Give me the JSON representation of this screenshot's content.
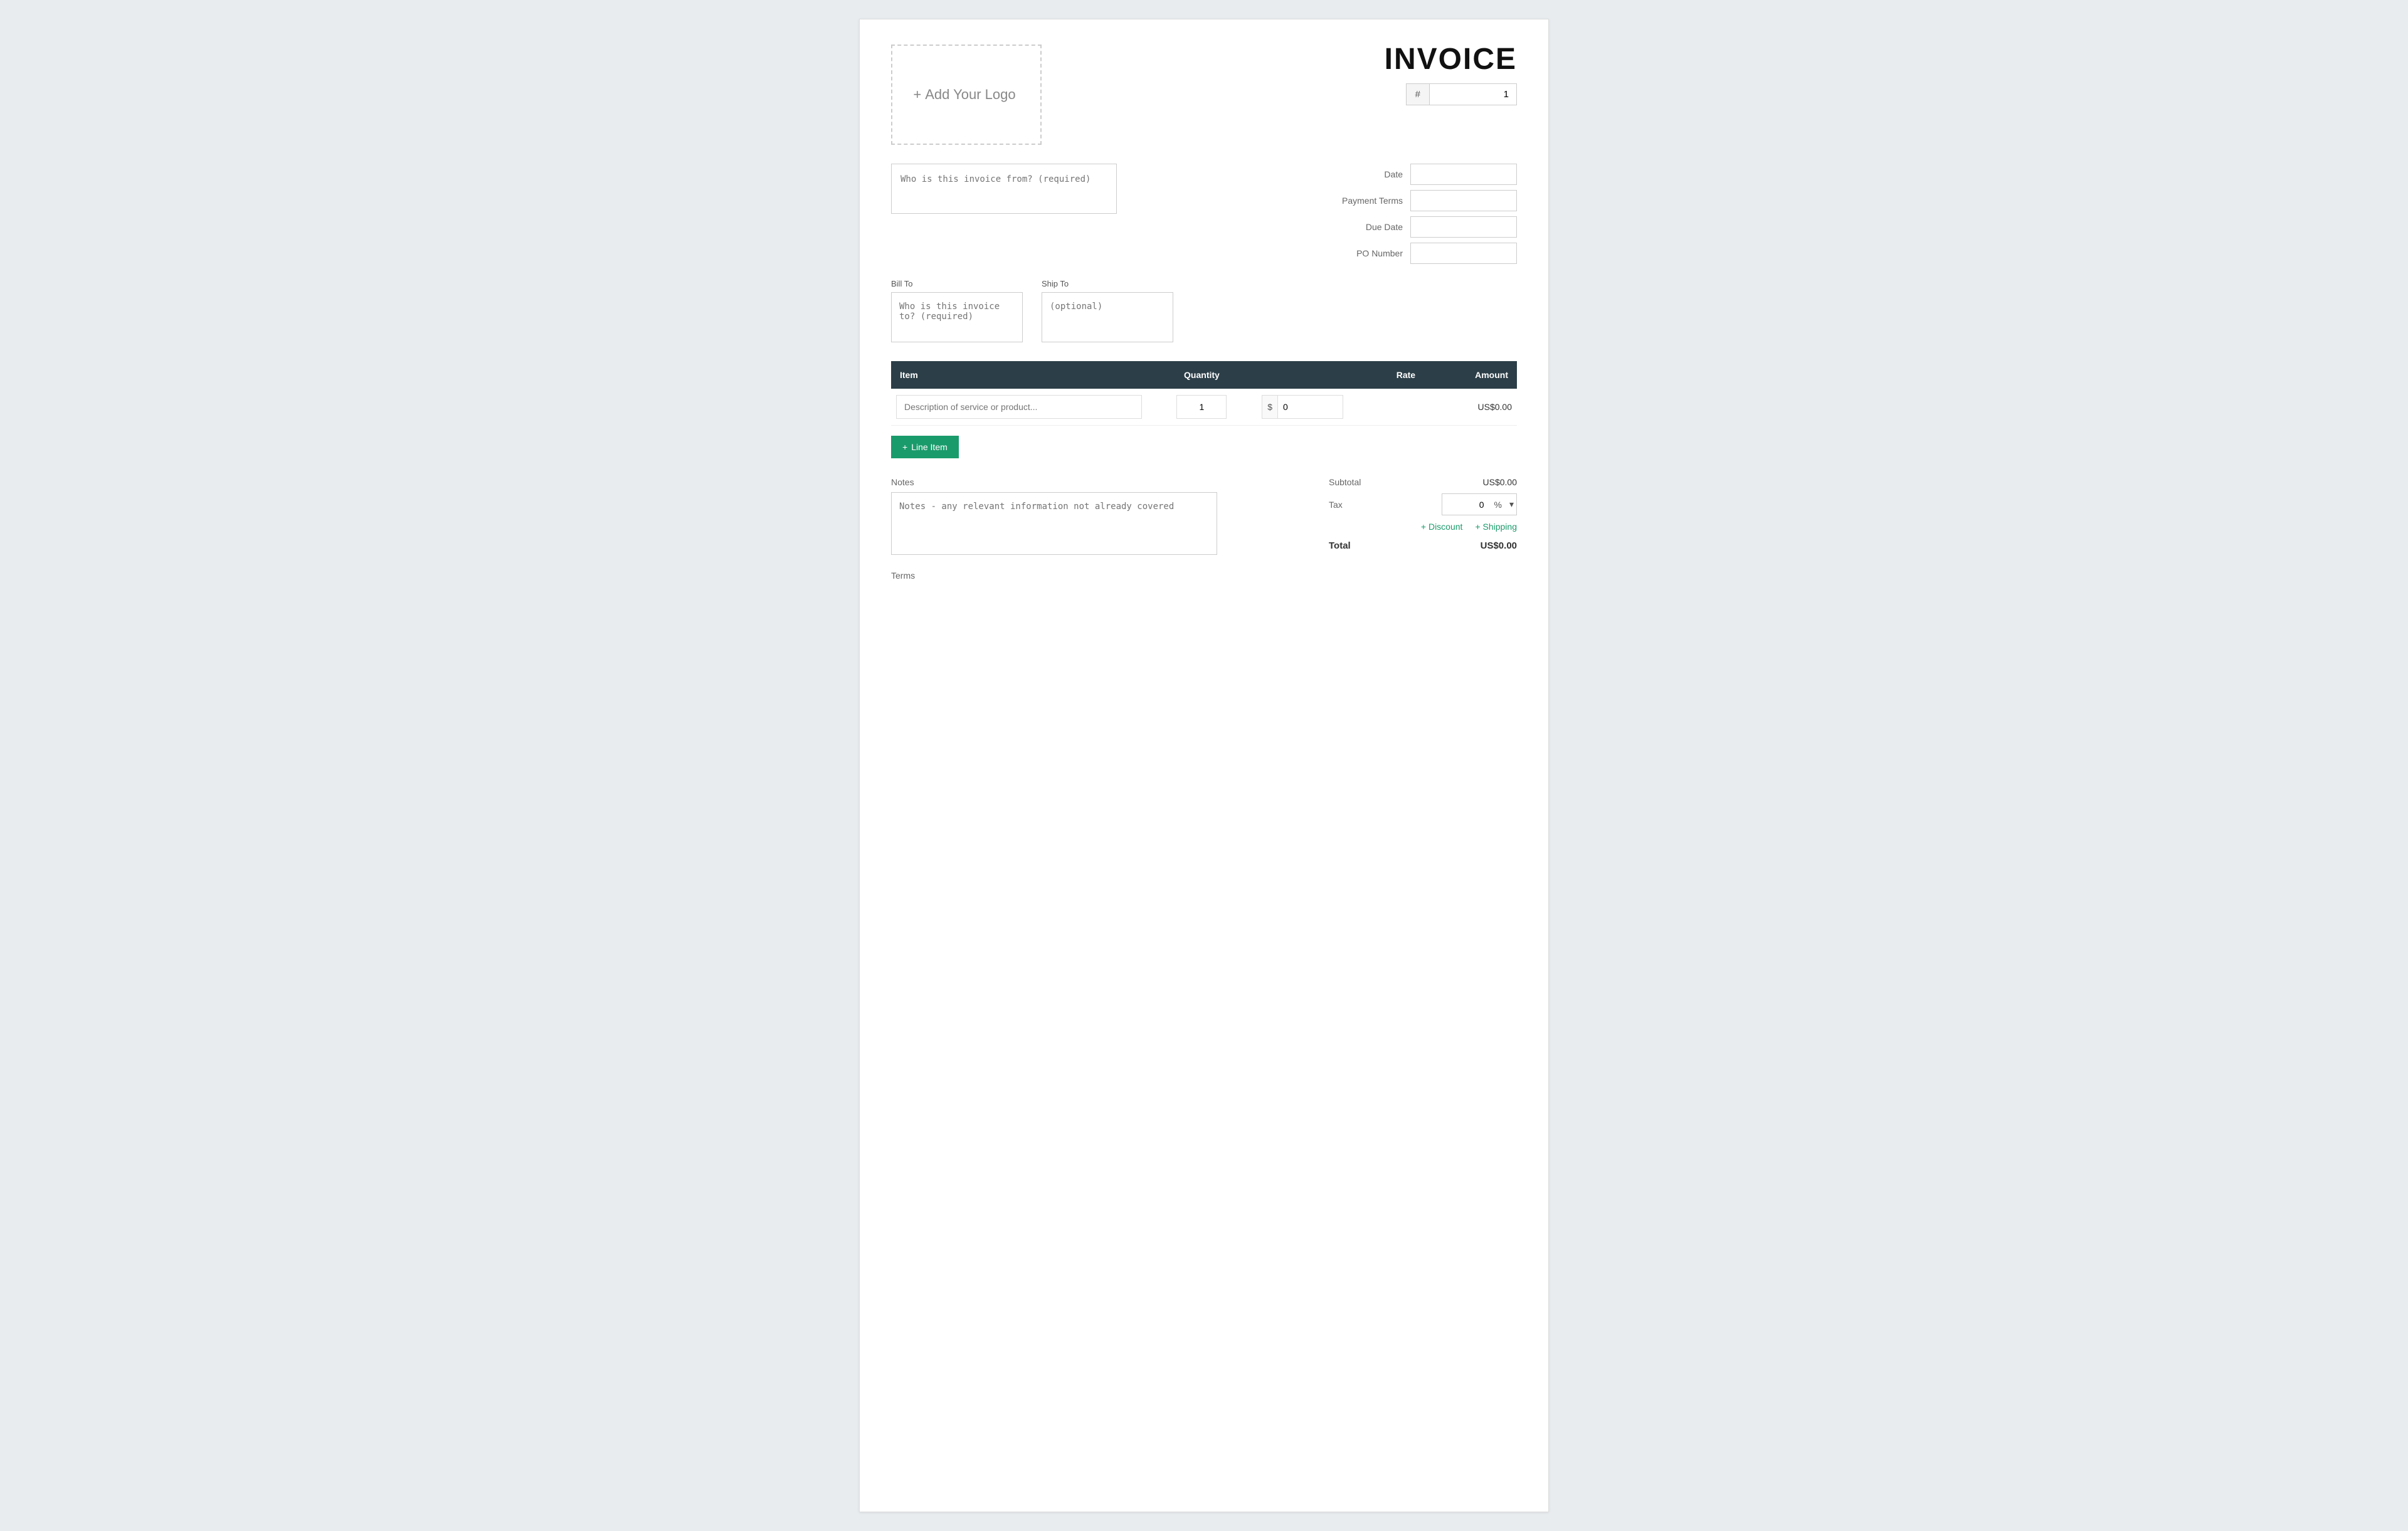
{
  "invoice": {
    "title": "INVOICE",
    "number_hash": "#",
    "number_value": "1",
    "from_placeholder": "Who is this invoice from? (required)",
    "bill_to_label": "Bill To",
    "ship_to_label": "Ship To",
    "bill_to_placeholder": "Who is this invoice to? (required)",
    "ship_to_placeholder": "(optional)",
    "date_label": "Date",
    "payment_terms_label": "Payment Terms",
    "due_date_label": "Due Date",
    "po_number_label": "PO Number",
    "logo_add_text": "Add Your Logo",
    "logo_add_icon": "+"
  },
  "table": {
    "col_item": "Item",
    "col_quantity": "Quantity",
    "col_rate": "Rate",
    "col_amount": "Amount",
    "item_placeholder": "Description of service or product...",
    "quantity_value": "1",
    "rate_currency_symbol": "$",
    "rate_value": "0",
    "amount_value": "US$0.00"
  },
  "add_line": {
    "icon": "+",
    "label": "Line Item"
  },
  "notes": {
    "label": "Notes",
    "placeholder": "Notes - any relevant information not already covered"
  },
  "terms": {
    "label": "Terms"
  },
  "totals": {
    "subtotal_label": "Subtotal",
    "subtotal_value": "US$0.00",
    "tax_label": "Tax",
    "tax_value": "0",
    "tax_percent": "%",
    "discount_label": "+ Discount",
    "shipping_label": "+ Shipping",
    "total_label": "Total",
    "total_value": "US$0.00"
  }
}
